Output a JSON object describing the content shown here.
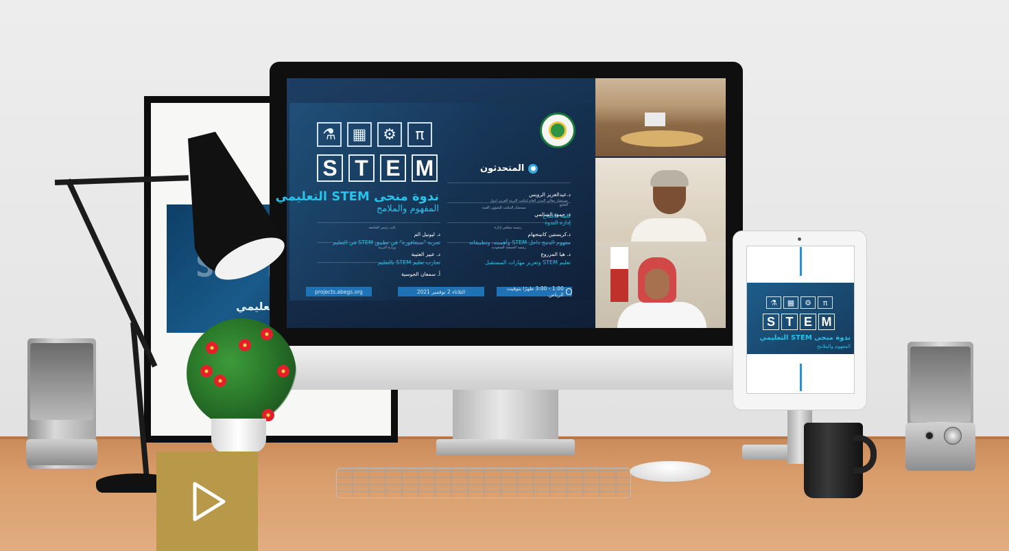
{
  "slide": {
    "icons": [
      "⚗",
      "▦",
      "⚙",
      "π"
    ],
    "letters": [
      "S",
      "T",
      "E",
      "M"
    ],
    "title": "ندوة منحى STEM التعليمي",
    "subtitle": "المفهوم والملامح",
    "speakers_title": "المتحدثون",
    "speakers_right": [
      {
        "name": "د.عبدالعزيز الرويس",
        "role": "مستشار معالي المدير العام لمكتب التربية العربي لدول الخليج",
        "topic": "كلمة الافتتاح"
      },
      {
        "name": "د. حمود السالمي",
        "role": "مستشار المكتب للشؤون الفنية",
        "topic": "إدارة الندوة"
      },
      {
        "name": "د.كريستين كانينجهام",
        "role": "رئيسة مجلس إدارة",
        "topic": "مفهوم الدمج داخل STEM وأهميته، وتطبيقاته"
      },
      {
        "name": "د. هيا المزروع",
        "role": "رئيسة الجمعية السعودية",
        "topic": "تعليم STEM وتعزيز مهارات المستقبل"
      }
    ],
    "speakers_left": [
      {
        "name": "د. ليونيل الم",
        "role": "نائب رئيس الجامعة",
        "topic": "تجربة \"سنغافورة\" في تطبيق STEM في التعليم"
      },
      {
        "name": "د. عبير العتيبة",
        "role": "وزارة التربية",
        "topic": "تجارب تعليم STEM بالتعليم"
      },
      {
        "name": "أ. سمعان الجوسية",
        "role": "",
        "topic": ""
      }
    ],
    "info": {
      "website": "projects.abegs.org",
      "date": "الثلاثاء 2 نوفمبر 2021",
      "time": "1:00 - 3:00 ظهرًا بتوقيت الرياض"
    }
  },
  "poster": {
    "title": "STEM التعليمي"
  },
  "tablet": {
    "icons": [
      "⚗",
      "▦",
      "⚙",
      "π"
    ],
    "letters": [
      "S",
      "T",
      "E",
      "M"
    ],
    "title": "ندوة منحى STEM التعليمي",
    "subtitle": "المفهوم والملامح"
  },
  "colors": {
    "accent": "#28c2ea",
    "slide_bg": "#173353",
    "play_button": "#b89849"
  },
  "play_button": {
    "icon": "play-icon"
  }
}
